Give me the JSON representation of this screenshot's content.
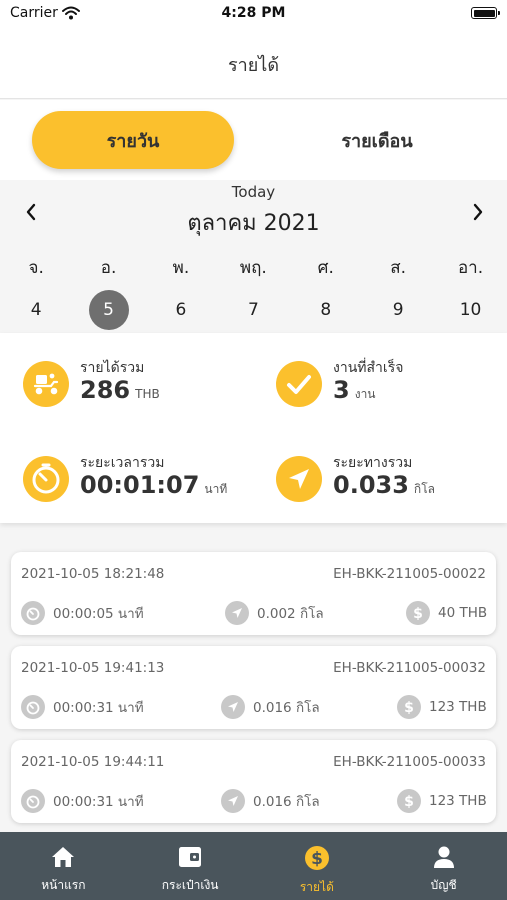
{
  "status_bar": {
    "carrier": "Carrier",
    "time": "4:28 PM"
  },
  "header": {
    "title": "รายได้"
  },
  "segment": {
    "daily": "รายวัน",
    "monthly": "รายเดือน"
  },
  "calendar": {
    "today_label": "Today",
    "month": "ตุลาคม 2021",
    "weekdays": [
      "จ.",
      "อ.",
      "พ.",
      "พฤ.",
      "ศ.",
      "ส.",
      "อา."
    ],
    "dates": [
      "4",
      "5",
      "6",
      "7",
      "8",
      "9",
      "10"
    ],
    "selected_date": "5"
  },
  "summary": {
    "income": {
      "label": "รายได้รวม",
      "value": "286",
      "unit": "THB"
    },
    "jobs": {
      "label": "งานที่สำเร็จ",
      "value": "3",
      "unit": "งาน"
    },
    "duration": {
      "label": "ระยะเวลารวม",
      "value": "00:01:07",
      "unit": "นาที"
    },
    "distance": {
      "label": "ระยะทางรวม",
      "value": "0.033",
      "unit": "กิโล"
    }
  },
  "jobs": [
    {
      "datetime": "2021-10-05 18:21:48",
      "code": "EH-BKK-211005-00022",
      "duration": "00:00:05 นาที",
      "distance": "0.002 กิโล",
      "amount": "40 THB"
    },
    {
      "datetime": "2021-10-05 19:41:13",
      "code": "EH-BKK-211005-00032",
      "duration": "00:00:31 นาที",
      "distance": "0.016 กิโล",
      "amount": "123 THB"
    },
    {
      "datetime": "2021-10-05 19:44:11",
      "code": "EH-BKK-211005-00033",
      "duration": "00:00:31 นาที",
      "distance": "0.016 กิโล",
      "amount": "123 THB"
    }
  ],
  "tabbar": {
    "home": "หน้าแรก",
    "wallet": "กระเป๋าเงิน",
    "income": "รายได้",
    "account": "บัญชี"
  },
  "colors": {
    "accent": "#fbc02d",
    "tabbar": "#4a555c",
    "selected_date": "#6f6f6f"
  },
  "icons": {
    "summary": [
      "delivery-scooter-icon",
      "checkmark-icon",
      "stopwatch-icon",
      "navigation-arrow-icon"
    ],
    "job_row": [
      "stopwatch-icon",
      "navigation-arrow-icon",
      "dollar-coin-icon"
    ],
    "tabbar": [
      "home-icon",
      "wallet-icon",
      "dollar-coin-icon",
      "person-icon"
    ]
  }
}
